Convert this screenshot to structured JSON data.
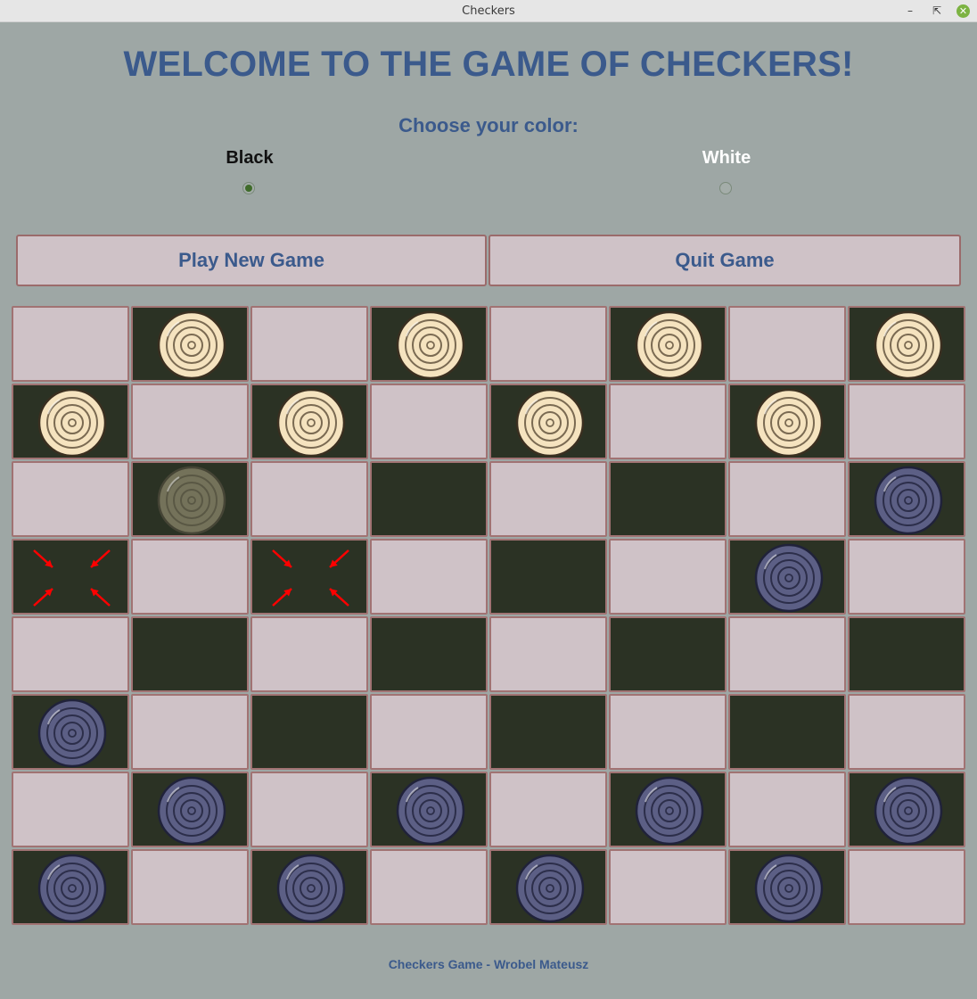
{
  "window": {
    "title": "Checkers",
    "controls": [
      "minimize-icon",
      "maximize-icon",
      "close-icon"
    ]
  },
  "heading": "WELCOME TO THE GAME OF CHECKERS!",
  "color_chooser": {
    "prompt": "Choose your color:",
    "options": [
      {
        "label": "Black",
        "selected": true
      },
      {
        "label": "White",
        "selected": false
      }
    ]
  },
  "buttons": {
    "play": "Play New Game",
    "quit": "Quit Game"
  },
  "board": {
    "rows": [
      [
        null,
        "white",
        null,
        "white",
        null,
        "white",
        null,
        "white"
      ],
      [
        "white",
        null,
        "white",
        null,
        "white",
        null,
        "white",
        null
      ],
      [
        null,
        "white-faded",
        null,
        null,
        null,
        null,
        null,
        "black"
      ],
      [
        "move-target",
        null,
        "move-target",
        null,
        null,
        null,
        "black",
        null
      ],
      [
        null,
        null,
        null,
        null,
        null,
        null,
        null,
        null
      ],
      [
        "black",
        null,
        null,
        null,
        null,
        null,
        null,
        null
      ],
      [
        null,
        "black",
        null,
        "black",
        null,
        "black",
        null,
        "black"
      ],
      [
        "black",
        null,
        "black",
        null,
        "black",
        null,
        "black",
        null
      ]
    ],
    "colors": {
      "light_square": "#cfc2c7",
      "dark_square": "#2b3224",
      "white_piece": "#f5e3bf",
      "black_piece": "#5c5f85",
      "move_arrow": "#ff0000"
    }
  },
  "footer": "Checkers Game - Wrobel Mateusz"
}
